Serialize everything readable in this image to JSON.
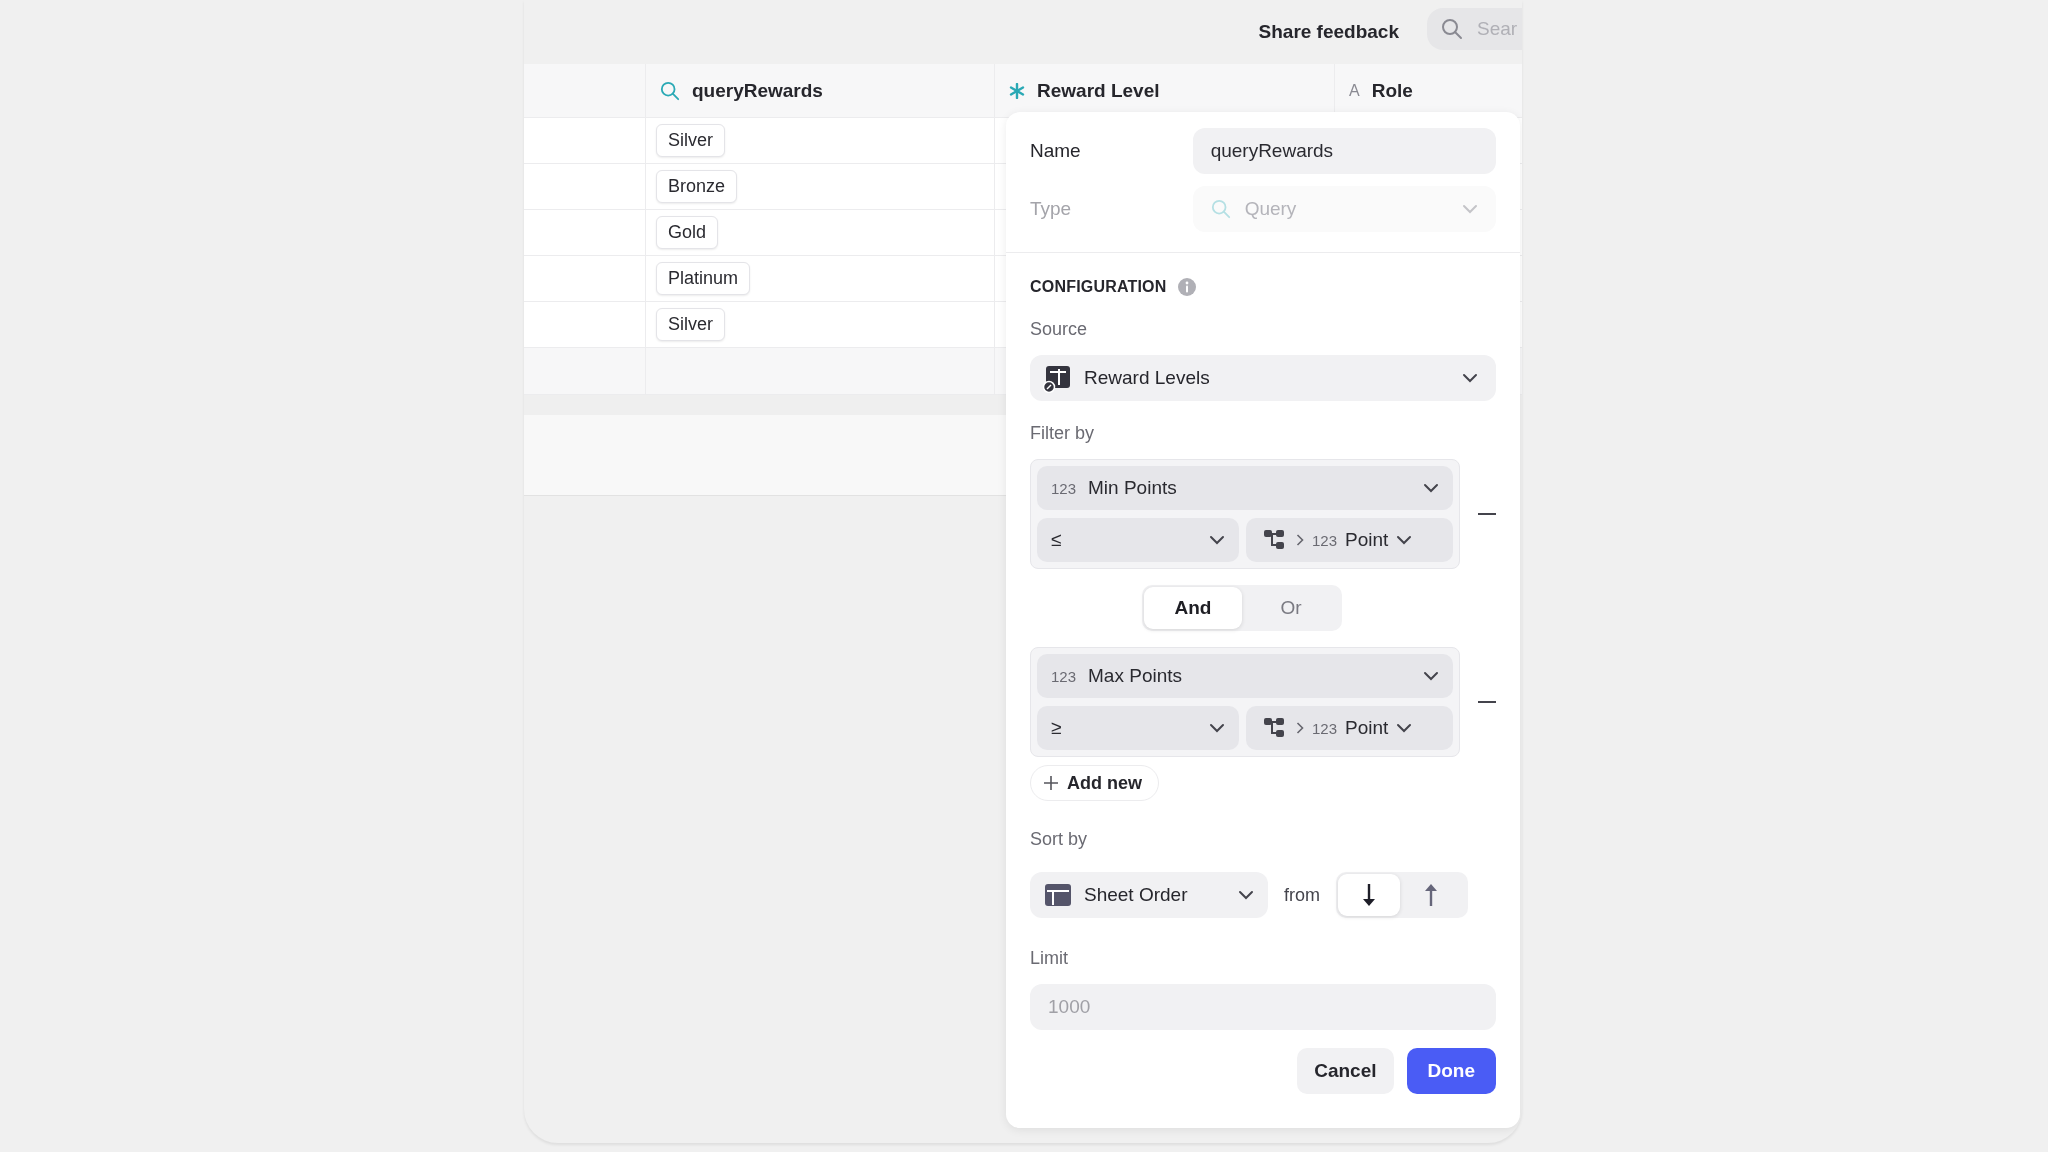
{
  "top_bar": {
    "share_feedback": "Share feedback",
    "search": {
      "placeholder": "Sear"
    }
  },
  "table": {
    "columns": [
      {
        "label": "queryRewards",
        "kind": "query"
      },
      {
        "label": "Reward Level",
        "kind": "select"
      },
      {
        "label": "Role",
        "kind": "text",
        "glyph": "A"
      }
    ],
    "rows": [
      {
        "query_rewards": "Silver"
      },
      {
        "query_rewards": "Bronze"
      },
      {
        "query_rewards": "Gold"
      },
      {
        "query_rewards": "Platinum"
      },
      {
        "query_rewards": "Silver"
      }
    ]
  },
  "panel": {
    "name": {
      "label": "Name",
      "value": "queryRewards"
    },
    "type": {
      "label": "Type",
      "value": "Query",
      "disabled": true
    },
    "configuration": {
      "title": "CONFIGURATION"
    },
    "source": {
      "label": "Source",
      "value": "Reward Levels"
    },
    "filter": {
      "label": "Filter by",
      "conditions": [
        {
          "field_type": "123",
          "field": "Min Points",
          "operator": "≤",
          "value_type": "123",
          "value": "Point"
        },
        {
          "field_type": "123",
          "field": "Max Points",
          "operator": "≥",
          "value_type": "123",
          "value": "Point"
        }
      ],
      "joiners": [
        {
          "label": "And",
          "selected": true
        },
        {
          "label": "Or",
          "selected": false
        }
      ],
      "add_button": "Add new"
    },
    "sort": {
      "label": "Sort by",
      "value": "Sheet Order",
      "from_label": "from",
      "directions": [
        {
          "kind": "down",
          "selected": true
        },
        {
          "kind": "up",
          "selected": false
        }
      ]
    },
    "limit": {
      "label": "Limit",
      "placeholder": "1000"
    },
    "buttons": [
      {
        "label": "Cancel",
        "kind": "secondary"
      },
      {
        "label": "Done",
        "kind": "primary"
      }
    ]
  }
}
